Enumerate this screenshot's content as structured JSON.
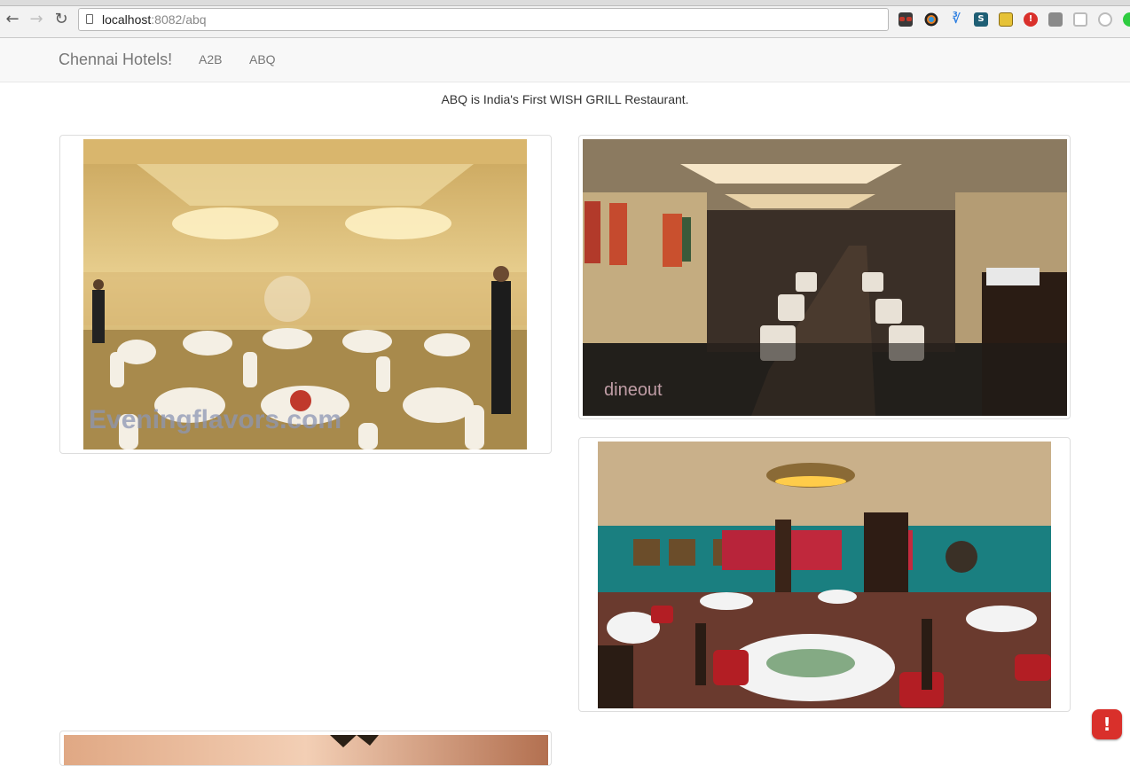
{
  "browser": {
    "url_host": "localhost",
    "url_rest": ":8082/abq",
    "extensions": [
      "glasses-icon",
      "color-wheel-icon",
      "bluetooth-icon",
      "s-extension-icon",
      "ruler-icon",
      "alert-extension-icon",
      "puzzle-icon",
      "square-icon",
      "circle-outline-icon"
    ],
    "extension_glyphs": {
      "s": "S",
      "alert": "!"
    }
  },
  "navbar": {
    "brand": "Chennai Hotels!",
    "links": [
      "A2B",
      "ABQ"
    ]
  },
  "main": {
    "tagline": "ABQ is India's First WISH GRILL Restaurant.",
    "photos": [
      {
        "caption": "",
        "watermark": "Eveningflavors.com"
      },
      {
        "caption": "",
        "watermark": "dineout"
      },
      {
        "caption": "",
        "watermark": ""
      },
      {
        "caption": "",
        "watermark": ""
      }
    ]
  },
  "overlay": {
    "error_badge": "!"
  },
  "colors": {
    "navbar_bg": "#f8f8f8",
    "link": "#777777",
    "error": "#d9302b"
  }
}
